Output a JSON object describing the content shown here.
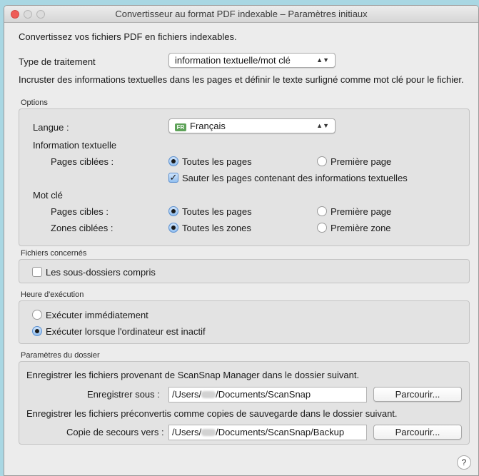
{
  "window": {
    "title": "Convertisseur au format PDF indexable – Paramètres initiaux"
  },
  "intro": "Convertissez vos fichiers PDF en fichiers indexables.",
  "processing": {
    "label": "Type de traitement",
    "value": "information textuelle/mot clé",
    "description": "Incruster des informations textuelles dans les pages et définir le texte surligné comme mot clé pour le fichier."
  },
  "options": {
    "title": "Options",
    "language_label": "Langue :",
    "language_flag": "FR",
    "language_value": "Français",
    "text_info": {
      "heading": "Information textuelle",
      "pages_label": "Pages ciblées :",
      "opt_all": "Toutes les pages",
      "opt_first": "Première page",
      "selected": "all",
      "skip_label": "Sauter les pages contenant des informations textuelles",
      "skip_checked": true
    },
    "keyword": {
      "heading": "Mot clé",
      "pages_label": "Pages cibles :",
      "pages_all": "Toutes les pages",
      "pages_first": "Première page",
      "pages_selected": "all",
      "zones_label": "Zones ciblées :",
      "zones_all": "Toutes les zones",
      "zones_first": "Première zone",
      "zones_selected": "all"
    }
  },
  "files": {
    "title": "Fichiers concernés",
    "subfolders_label": "Les sous-dossiers compris",
    "subfolders_checked": false
  },
  "schedule": {
    "title": "Heure d'exécution",
    "now_label": "Exécuter immédiatement",
    "idle_label": "Exécuter lorsque l'ordinateur est inactif",
    "selected": "idle"
  },
  "folder": {
    "title": "Paramètres du dossier",
    "save_desc": "Enregistrer les fichiers provenant de ScanSnap Manager dans le dossier suivant.",
    "save_label": "Enregistrer sous :",
    "save_prefix": "/Users/",
    "save_suffix": "/Documents/ScanSnap",
    "browse_label": "Parcourir...",
    "backup_desc": "Enregistrer les fichiers préconvertis comme copies de sauvegarde dans le dossier suivant.",
    "backup_label": "Copie de secours vers :",
    "backup_prefix": "/Users/",
    "backup_suffix": "/Documents/ScanSnap/Backup",
    "browse2_label": "Parcourir..."
  },
  "help_label": "?"
}
